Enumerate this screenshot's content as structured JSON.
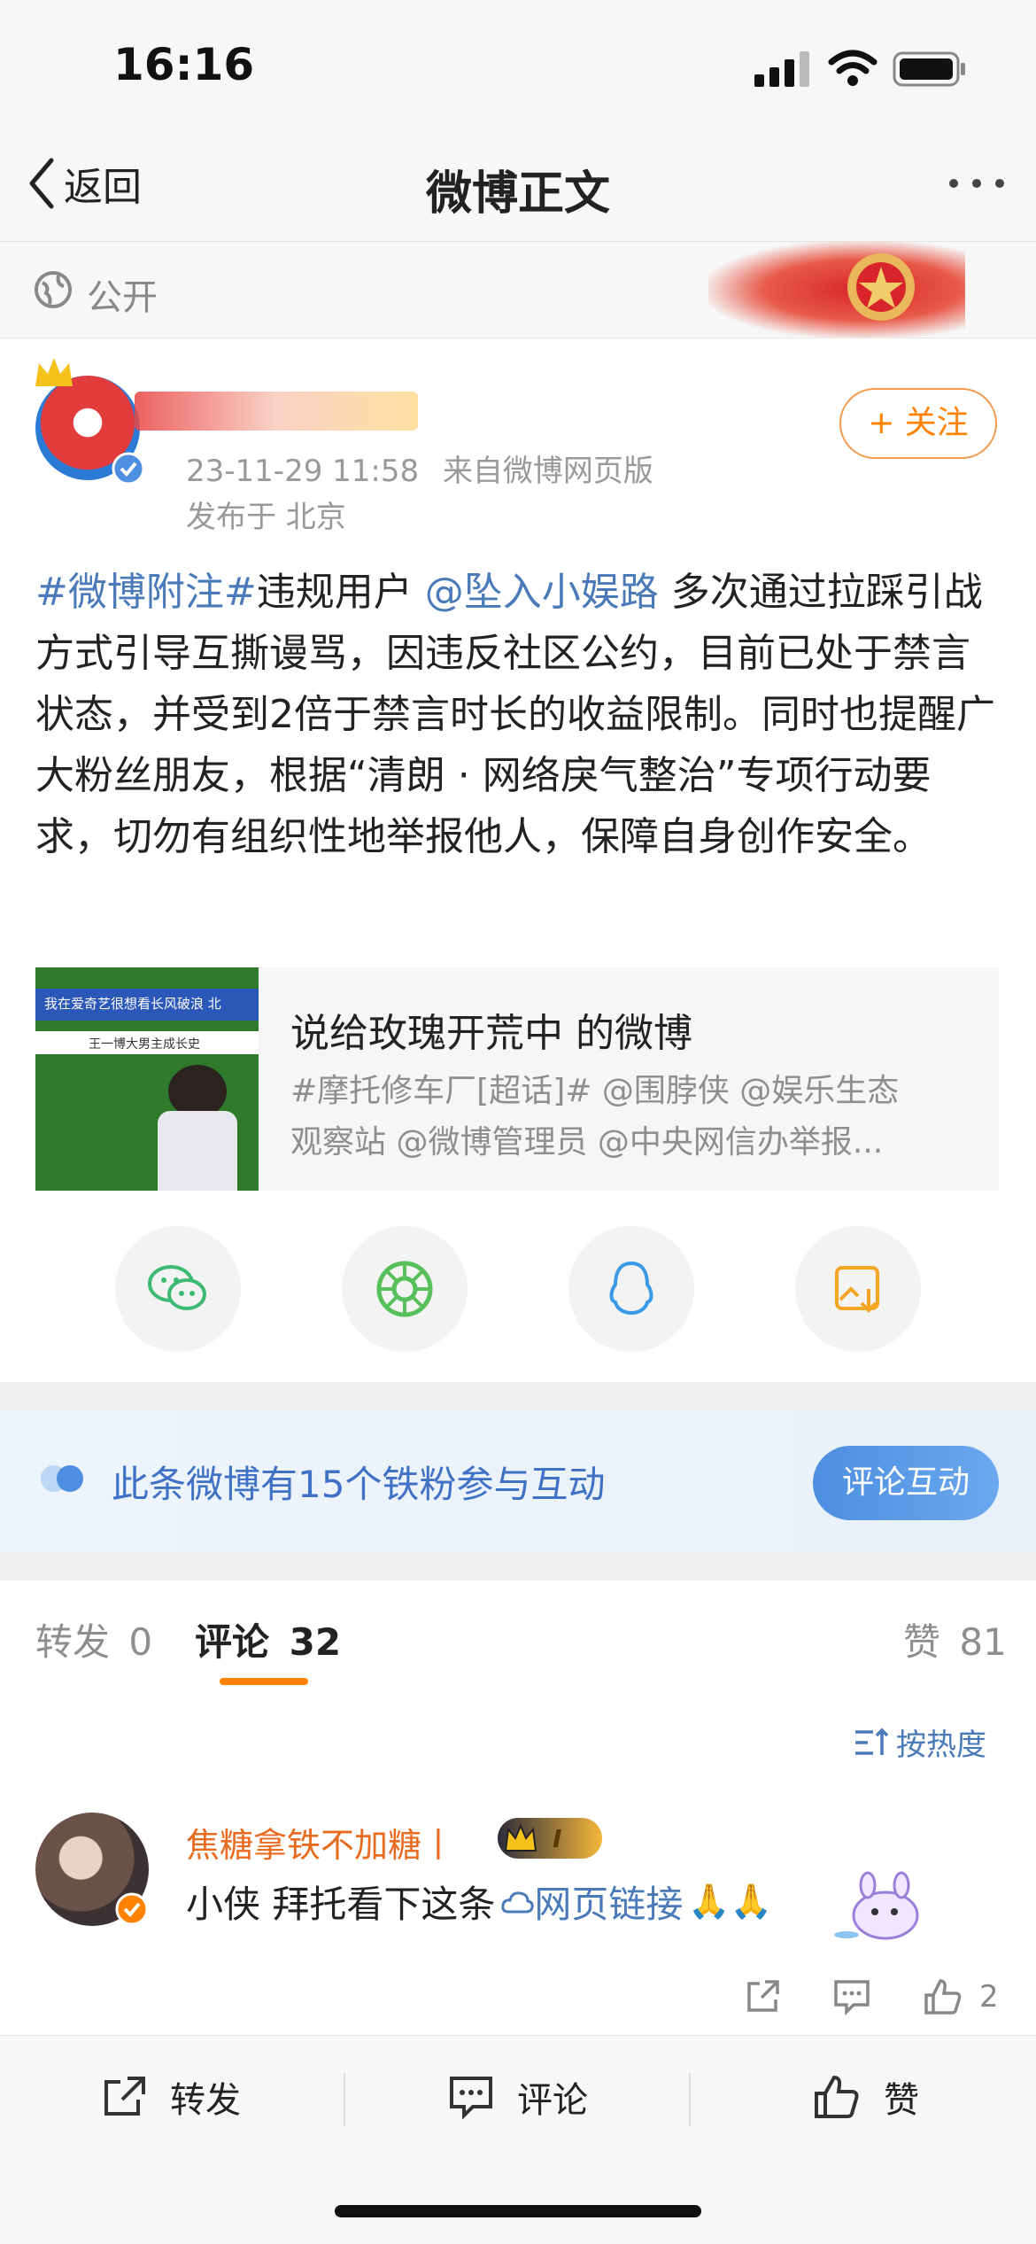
{
  "status_bar": {
    "time": "16:16"
  },
  "nav": {
    "back_label": "返回",
    "title": "微博正文"
  },
  "visibility": {
    "label": "公开"
  },
  "post": {
    "timestamp": "23-11-29 11:58",
    "source": "来自微博网页版",
    "location": "发布于 北京",
    "follow_label": "+ 关注",
    "hashtag": "#微博附注#",
    "text_1": "违规用户 ",
    "mention": "@坠入小娱路",
    "text_2": " 多次通过拉踩引战方式引导互撕谩骂，因违反社区公约，目前已处于禁言状态，并受到2倍于禁言时长的收益限制。同时也提醒广大粉丝朋友，根据“清朗 · 网络戾气整治”专项行动要求，切勿有组织性地举报他人，保障自身创作安全。",
    "quote": {
      "title": "说给玫瑰开荒中 的微博",
      "excerpt_1": "#摩托修车厂[超话]# @围脖侠 @娱乐生态",
      "excerpt_2": "观察站 @微博管理员  @中央网信办举报...",
      "thumb_banner": "我在爱奇艺很想看长风破浪  北",
      "thumb_sub": "王一博大男主成长史"
    },
    "share_icons": [
      "wechat-icon",
      "moments-icon",
      "qq-icon",
      "save-image-icon"
    ]
  },
  "fans_banner": {
    "text": "此条微博有15个铁粉参与互动",
    "button": "评论互动"
  },
  "tabs": {
    "repost": {
      "label": "转发",
      "count": "0"
    },
    "comment": {
      "label": "评论",
      "count": "32"
    },
    "like": {
      "label": "赞",
      "count": "81"
    },
    "sort_label": "按热度"
  },
  "comments": [
    {
      "username": "焦糖拿铁不加糖丨",
      "badge": "I",
      "text": "小侠 拜托看下这条",
      "link": "网页链接",
      "like_count": "2"
    }
  ],
  "bottom": {
    "repost": "转发",
    "comment": "评论",
    "like": "赞"
  },
  "colors": {
    "link": "#4a7ab8",
    "accent_orange": "#ff8200",
    "username_orange": "#e86b1f",
    "button_blue": "#4d8fe0"
  }
}
